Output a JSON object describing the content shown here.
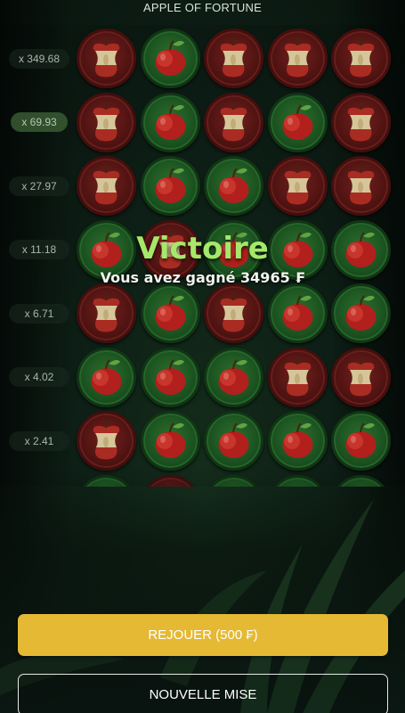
{
  "game": {
    "title": "APPLE OF FORTUNE"
  },
  "multipliers": [
    {
      "label": "x 349.68",
      "active": false
    },
    {
      "label": "x 69.93",
      "active": true
    },
    {
      "label": "x 27.97",
      "active": false
    },
    {
      "label": "x 11.18",
      "active": false
    },
    {
      "label": "x 6.71",
      "active": false
    },
    {
      "label": "x 4.02",
      "active": false
    },
    {
      "label": "x 2.41",
      "active": false
    },
    {
      "label": "",
      "active": false
    }
  ],
  "grid": [
    [
      "bitten",
      "apple",
      "bitten",
      "bitten",
      "bitten"
    ],
    [
      "bitten",
      "apple",
      "bitten",
      "apple",
      "bitten"
    ],
    [
      "bitten",
      "apple",
      "apple",
      "bitten",
      "bitten"
    ],
    [
      "apple",
      "bitten",
      "apple",
      "apple",
      "apple"
    ],
    [
      "bitten",
      "apple",
      "bitten",
      "apple",
      "apple"
    ],
    [
      "apple",
      "apple",
      "apple",
      "bitten",
      "bitten"
    ],
    [
      "bitten",
      "apple",
      "apple",
      "apple",
      "apple"
    ],
    [
      "apple",
      "bitten",
      "apple",
      "apple",
      "apple"
    ]
  ],
  "result": {
    "heading": "Victoire",
    "message": "Vous avez gagné 34965 ₣"
  },
  "buttons": {
    "replay": "REJOUER (500 ₣)",
    "new_bet": "NOUVELLE MISE"
  },
  "colors": {
    "win_text": "#a6e86a",
    "replay_button": "#e5b933",
    "apple_tile": "#1f5c24",
    "bitten_tile": "#5a1614"
  }
}
